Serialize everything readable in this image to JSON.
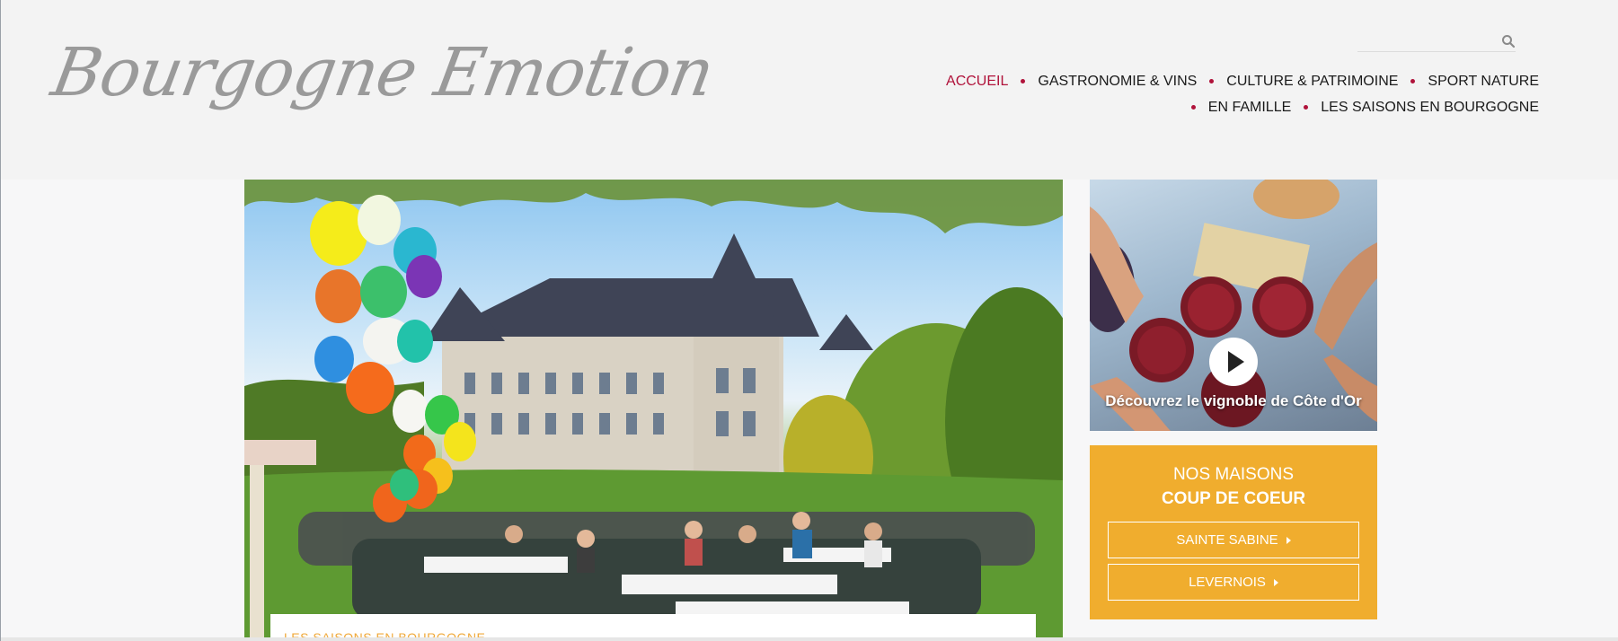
{
  "header": {
    "logo_text": "Bourgogne Emotion",
    "search_placeholder": "",
    "nav": {
      "row1": [
        "ACCUEIL",
        "GASTRONOMIE & VINS",
        "CULTURE & PATRIMOINE",
        "SPORT NATURE"
      ],
      "row2": [
        "EN FAMILLE",
        "LES SAISONS EN BOURGOGNE"
      ],
      "active": "ACCUEIL"
    }
  },
  "hero": {
    "category_label": "LES SAISONS EN BOURGOGNE"
  },
  "video": {
    "caption": "Découvrez le vignoble de Côte d'Or"
  },
  "promo": {
    "title_line1": "NOS MAISONS",
    "title_line2": "COUP DE COEUR",
    "buttons": [
      "SAINTE SABINE",
      "LEVERNOIS"
    ]
  },
  "colors": {
    "accent_red": "#b0123a",
    "promo_orange": "#f0ad2e",
    "header_bg": "#f3f3f3"
  },
  "icons": [
    "search-icon",
    "play-icon",
    "caret-right-icon"
  ]
}
